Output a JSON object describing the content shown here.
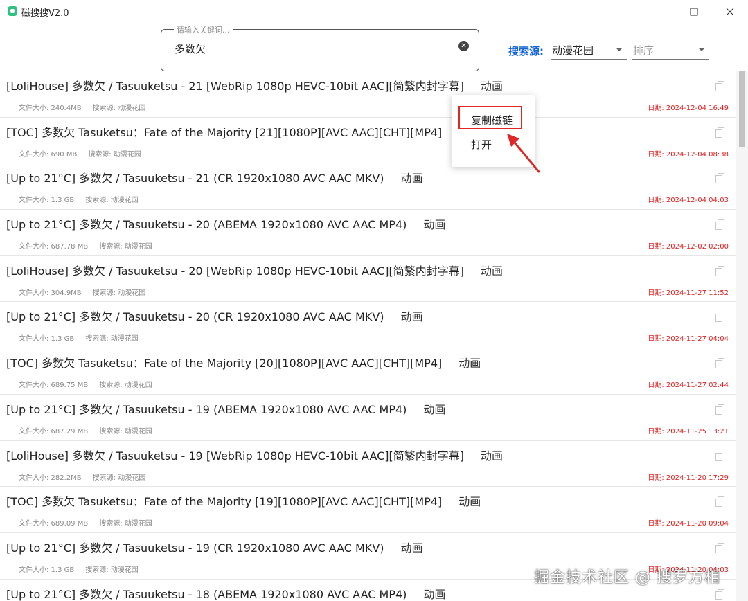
{
  "window": {
    "title": "磁搜搜V2.0",
    "icon": "app-icon",
    "accent": "#2ec27e"
  },
  "search": {
    "label": "请输入关键词...",
    "value": "多数欠"
  },
  "filters": {
    "source_label": "搜索源:",
    "source_value": "动漫花园",
    "sort_placeholder": "排序",
    "source_label_color": "#1565d8"
  },
  "context_menu": {
    "copy_label": "复制磁链",
    "open_label": "打开",
    "highlight_color": "#e02727"
  },
  "results": [
    {
      "title": "[LoliHouse] 多数欠 / Tasuuketsu - 21 [WebRip 1080p HEVC-10bit AAC][简繁内封字幕]",
      "type": "动画",
      "size": "文件大小: 240.4MB",
      "source": "搜索源: 动漫花园",
      "date": "日期: 2024-12-04 16:49"
    },
    {
      "title": "[TOC] 多数欠 Tasuketsu：Fate of the Majority [21][1080P][AVC AAC][CHT][MP4]",
      "type": "动画",
      "size": "文件大小: 690 MB",
      "source": "搜索源: 动漫花园",
      "date": "日期: 2024-12-04 08:38"
    },
    {
      "title": "[Up to 21°C] 多数欠 / Tasuuketsu - 21 (CR 1920x1080 AVC AAC MKV)",
      "type": "动画",
      "size": "文件大小: 1.3 GB",
      "source": "搜索源: 动漫花园",
      "date": "日期: 2024-12-04 04:03"
    },
    {
      "title": "[Up to 21°C] 多数欠 / Tasuuketsu - 20 (ABEMA 1920x1080 AVC AAC MP4)",
      "type": "动画",
      "size": "文件大小: 687.78 MB",
      "source": "搜索源: 动漫花园",
      "date": "日期: 2024-12-02 02:00"
    },
    {
      "title": "[LoliHouse] 多数欠 / Tasuuketsu - 20 [WebRip 1080p HEVC-10bit AAC][简繁内封字幕]",
      "type": "动画",
      "size": "文件大小: 304.9MB",
      "source": "搜索源: 动漫花园",
      "date": "日期: 2024-11-27 11:52"
    },
    {
      "title": "[Up to 21°C] 多数欠 / Tasuuketsu - 20 (CR 1920x1080 AVC AAC MKV)",
      "type": "动画",
      "size": "文件大小: 1.3 GB",
      "source": "搜索源: 动漫花园",
      "date": "日期: 2024-11-27 04:04"
    },
    {
      "title": "[TOC] 多数欠 Tasuketsu：Fate of the Majority [20][1080P][AVC AAC][CHT][MP4]",
      "type": "动画",
      "size": "文件大小: 689.75 MB",
      "source": "搜索源: 动漫花园",
      "date": "日期: 2024-11-27 02:44"
    },
    {
      "title": "[Up to 21°C] 多数欠 / Tasuuketsu - 19 (ABEMA 1920x1080 AVC AAC MP4)",
      "type": "动画",
      "size": "文件大小: 687.29 MB",
      "source": "搜索源: 动漫花园",
      "date": "日期: 2024-11-25 13:21"
    },
    {
      "title": "[LoliHouse] 多数欠 / Tasuuketsu - 19 [WebRip 1080p HEVC-10bit AAC][简繁内封字幕]",
      "type": "动画",
      "size": "文件大小: 282.2MB",
      "source": "搜索源: 动漫花园",
      "date": "日期: 2024-11-20 17:29"
    },
    {
      "title": "[TOC] 多数欠 Tasuketsu：Fate of the Majority [19][1080P][AVC AAC][CHT][MP4]",
      "type": "动画",
      "size": "文件大小: 689.09 MB",
      "source": "搜索源: 动漫花园",
      "date": "日期: 2024-11-20 09:04"
    },
    {
      "title": "[Up to 21°C] 多数欠 / Tasuuketsu - 19 (CR 1920x1080 AVC AAC MKV)",
      "type": "动画",
      "size": "文件大小: 1.3 GB",
      "source": "搜索源: 动漫花园",
      "date": "日期: 2024-11-20 04:03"
    },
    {
      "title": "[Up to 21°C] 多数欠 / Tasuuketsu - 18 (ABEMA 1920x1080 AVC AAC MP4)",
      "type": "动画",
      "size": "",
      "source": "",
      "date": ""
    }
  ],
  "watermark": "掘金技术社区 @ 搜罗方相",
  "colors": {
    "date": "#e02020",
    "meta": "#8a8a8a"
  }
}
